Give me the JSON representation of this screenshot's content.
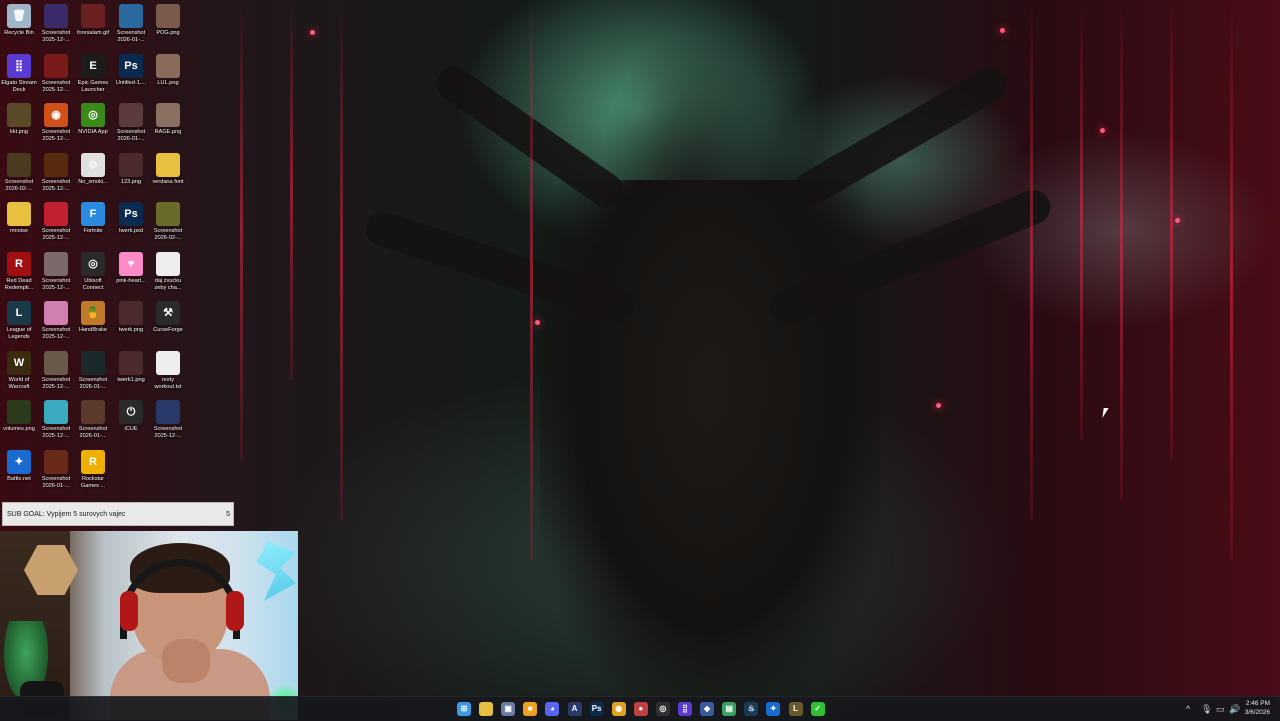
{
  "desktop": {
    "icons": [
      {
        "label": "Recycle Bin",
        "icon": "recycle-bin-icon",
        "color": "#9fb6c9",
        "glyph": "🗑"
      },
      {
        "label": "Screenshot 2025-12-...",
        "icon": "image-file-icon",
        "color": "#3a2a6a",
        "glyph": ""
      },
      {
        "label": "foresalam.gif",
        "icon": "gif-file-icon",
        "color": "#6a2020",
        "glyph": ""
      },
      {
        "label": "Screenshot 2026-01-...",
        "icon": "image-file-icon",
        "color": "#2a6aa0",
        "glyph": ""
      },
      {
        "label": "POG.png",
        "icon": "image-file-icon",
        "color": "#7a5a4a",
        "glyph": ""
      },
      {
        "label": "Elgato Stream Deck",
        "icon": "stream-deck-icon",
        "color": "#5a3ad0",
        "glyph": "⣿"
      },
      {
        "label": "Screenshot 2025-12-...",
        "icon": "image-file-icon",
        "color": "#7a1a1a",
        "glyph": ""
      },
      {
        "label": "Epic Games Launcher",
        "icon": "epic-games-icon",
        "color": "#1c1c1c",
        "glyph": "E"
      },
      {
        "label": "Untitled-1....",
        "icon": "photoshop-file-icon",
        "color": "#0a2a50",
        "glyph": "Ps"
      },
      {
        "label": "LUL.png",
        "icon": "image-file-icon",
        "color": "#8a6a5a",
        "glyph": ""
      },
      {
        "label": "kkt.png",
        "icon": "image-file-icon",
        "color": "#5a4a2a",
        "glyph": ""
      },
      {
        "label": "Screenshot 2025-12-...",
        "icon": "firefox-icon",
        "color": "#d0501a",
        "glyph": "◉"
      },
      {
        "label": "NVIDIA App",
        "icon": "nvidia-icon",
        "color": "#3a8a1a",
        "glyph": "◎"
      },
      {
        "label": "Screenshot 2026-01-...",
        "icon": "image-file-icon",
        "color": "#5a3a3a",
        "glyph": ""
      },
      {
        "label": "RAGE.png",
        "icon": "image-file-icon",
        "color": "#8a7060",
        "glyph": ""
      },
      {
        "label": "Screenshot 2026-02-...",
        "icon": "image-file-icon",
        "color": "#4a3a20",
        "glyph": ""
      },
      {
        "label": "Screenshot 2025-12-...",
        "icon": "image-file-icon",
        "color": "#5a2a10",
        "glyph": ""
      },
      {
        "label": "No_smoki...",
        "icon": "no-smoking-icon",
        "color": "#e0e0e0",
        "glyph": "⊘"
      },
      {
        "label": "123.png",
        "icon": "image-file-icon",
        "color": "#4a2a2a",
        "glyph": ""
      },
      {
        "label": "verdana font",
        "icon": "folder-icon",
        "color": "#e8c040",
        "glyph": ""
      },
      {
        "label": "mnoise",
        "icon": "folder-icon",
        "color": "#e8c040",
        "glyph": ""
      },
      {
        "label": "Screenshot 2025-12-...",
        "icon": "image-file-icon",
        "color": "#c02030",
        "glyph": ""
      },
      {
        "label": "Fortnite",
        "icon": "fortnite-icon",
        "color": "#2a8ae0",
        "glyph": "F"
      },
      {
        "label": "twerk.psd",
        "icon": "photoshop-file-icon",
        "color": "#0a2a50",
        "glyph": "Ps"
      },
      {
        "label": "Screenshot 2026-02-...",
        "icon": "image-file-icon",
        "color": "#6a6a2a",
        "glyph": ""
      },
      {
        "label": "Red Dead Redempti...",
        "icon": "red-dead-icon",
        "color": "#a01010",
        "glyph": "R"
      },
      {
        "label": "Screenshot 2025-12-...",
        "icon": "image-file-icon",
        "color": "#7a6a6a",
        "glyph": ""
      },
      {
        "label": "Ubisoft Connect",
        "icon": "ubisoft-icon",
        "color": "#2a2a2a",
        "glyph": "◎"
      },
      {
        "label": "pink-heart...",
        "icon": "heart-icon",
        "color": "#ff8ac8",
        "glyph": "♥"
      },
      {
        "label": "daj zvucku zeby cha...",
        "icon": "text-file-icon",
        "color": "#eeeeee",
        "glyph": ""
      },
      {
        "label": "League of Legends",
        "icon": "league-icon",
        "color": "#1a3a4a",
        "glyph": "L"
      },
      {
        "label": "Screenshot 2025-12-...",
        "icon": "image-file-icon",
        "color": "#d080b0",
        "glyph": ""
      },
      {
        "label": "HandBrake",
        "icon": "handbrake-icon",
        "color": "#c07a2a",
        "glyph": "🍍"
      },
      {
        "label": "twerk.png",
        "icon": "image-file-icon",
        "color": "#4a2a2a",
        "glyph": ""
      },
      {
        "label": "CurseForge",
        "icon": "curseforge-icon",
        "color": "#2a2a2a",
        "glyph": "⚒"
      },
      {
        "label": "World of Warcraft",
        "icon": "wow-icon",
        "color": "#3a2a10",
        "glyph": "W"
      },
      {
        "label": "Screenshot 2025-12-...",
        "icon": "image-file-icon",
        "color": "#6a5a4a",
        "glyph": ""
      },
      {
        "label": "Screenshot 2026-01-...",
        "icon": "image-file-icon",
        "color": "#1a2a2a",
        "glyph": ""
      },
      {
        "label": "twerk1.png",
        "icon": "image-file-icon",
        "color": "#4a2a2a",
        "glyph": ""
      },
      {
        "label": "resty workout.txt",
        "icon": "text-file-icon",
        "color": "#eeeeee",
        "glyph": ""
      },
      {
        "label": "volumes.png",
        "icon": "image-file-icon",
        "color": "#2a3a1a",
        "glyph": ""
      },
      {
        "label": "Screenshot 2025-12-...",
        "icon": "image-file-icon",
        "color": "#3aaac0",
        "glyph": ""
      },
      {
        "label": "Screenshot 2026-01-...",
        "icon": "image-file-icon",
        "color": "#5a3a2a",
        "glyph": ""
      },
      {
        "label": "iCUE",
        "icon": "icue-icon",
        "color": "#2a2a2a",
        "glyph": "⏻"
      },
      {
        "label": "Screenshot 2025-12-...",
        "icon": "image-file-icon",
        "color": "#2a3a6a",
        "glyph": ""
      },
      {
        "label": "Battle.net",
        "icon": "battlenet-icon",
        "color": "#1a6ad0",
        "glyph": "✦"
      },
      {
        "label": "Screenshot 2026-01-...",
        "icon": "image-file-icon",
        "color": "#6a2a1a",
        "glyph": ""
      },
      {
        "label": "Rockstar Games ...",
        "icon": "rockstar-icon",
        "color": "#f0b000",
        "glyph": "R"
      }
    ]
  },
  "overlay": {
    "sub_goal_text": "SUB GOAL: Vypijem 5 surovych vajec",
    "sub_goal_count": "5"
  },
  "taskbar": {
    "apps": [
      {
        "name": "start-button",
        "icon": "windows-icon",
        "color": "#3a9ae8",
        "glyph": "⊞"
      },
      {
        "name": "file-explorer",
        "icon": "folder-icon",
        "color": "#e8c040",
        "glyph": ""
      },
      {
        "name": "app-3",
        "icon": "monitor-icon",
        "color": "#6a7aa0",
        "glyph": "▣"
      },
      {
        "name": "app-4",
        "icon": "app-icon",
        "color": "#f0a020",
        "glyph": "■"
      },
      {
        "name": "discord",
        "icon": "discord-icon",
        "color": "#5865f2",
        "glyph": "◕"
      },
      {
        "name": "app-6",
        "icon": "app-icon",
        "color": "#2a3a6a",
        "glyph": "A"
      },
      {
        "name": "photoshop",
        "icon": "photoshop-icon",
        "color": "#0a2a50",
        "glyph": "Ps"
      },
      {
        "name": "chrome",
        "icon": "chrome-icon",
        "color": "#e0a020",
        "glyph": "◉"
      },
      {
        "name": "app-9",
        "icon": "app-icon",
        "color": "#c04040",
        "glyph": "●"
      },
      {
        "name": "obs",
        "icon": "obs-icon",
        "color": "#303030",
        "glyph": "◎"
      },
      {
        "name": "stream-deck",
        "icon": "stream-deck-icon",
        "color": "#5a3ad0",
        "glyph": "⣿"
      },
      {
        "name": "app-12",
        "icon": "app-icon",
        "color": "#3a5aa0",
        "glyph": "◆"
      },
      {
        "name": "app-13",
        "icon": "app-icon",
        "color": "#3aa060",
        "glyph": "▤"
      },
      {
        "name": "steam",
        "icon": "steam-icon",
        "color": "#1a3a5a",
        "glyph": "♨"
      },
      {
        "name": "battlenet",
        "icon": "battlenet-icon",
        "color": "#1a6ad0",
        "glyph": "✦"
      },
      {
        "name": "league",
        "icon": "league-icon",
        "color": "#6a5a2a",
        "glyph": "L"
      },
      {
        "name": "app-17",
        "icon": "app-icon",
        "color": "#30c030",
        "glyph": "✓"
      }
    ],
    "tray": {
      "chevron": "^",
      "clock_time": "2:46 PM",
      "clock_date": "3/6/2026"
    }
  }
}
